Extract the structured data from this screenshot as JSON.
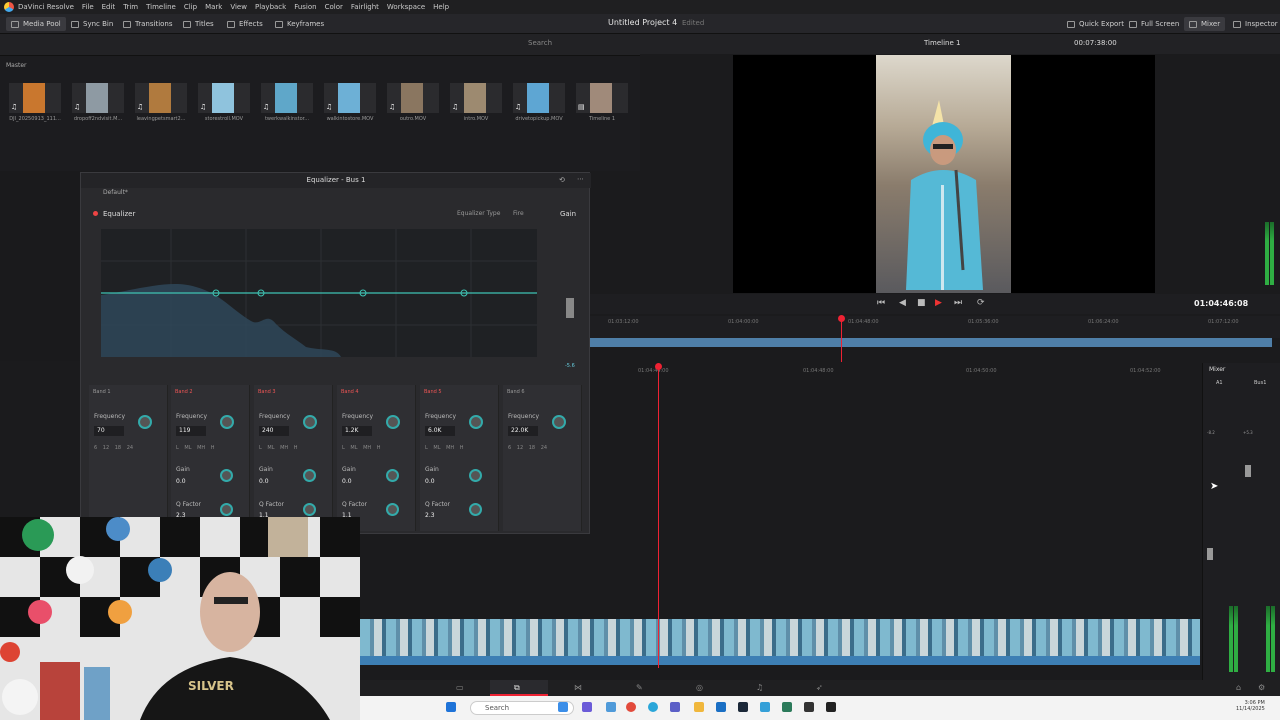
{
  "menu": [
    "DaVinci Resolve",
    "File",
    "Edit",
    "Trim",
    "Timeline",
    "Clip",
    "Mark",
    "View",
    "Playback",
    "Fusion",
    "Color",
    "Fairlight",
    "Workspace",
    "Help"
  ],
  "toolbar": {
    "media_pool": "Media Pool",
    "sync_bin": "Sync Bin",
    "transitions": "Transitions",
    "titles": "Titles",
    "effects": "Effects",
    "keyframes": "Keyframes",
    "project_title": "Untitled Project 4",
    "project_status": "Edited",
    "quick_export": "Quick Export",
    "full_screen": "Full Screen",
    "mixer": "Mixer",
    "inspector": "Inspector"
  },
  "media_pool": {
    "search_placeholder": "Search",
    "master": "Master",
    "clips": [
      {
        "name": "DJI_20250913_111...",
        "color": "#c9772e"
      },
      {
        "name": "dropoff2ndvisit.M...",
        "color": "#8e9aa3"
      },
      {
        "name": "leavingpetsmart2...",
        "color": "#b07a3e"
      },
      {
        "name": "storestroll.MOV",
        "color": "#8fc3dd"
      },
      {
        "name": "twerkwalkinstor...",
        "color": "#5fa7c9"
      },
      {
        "name": "walkintostore.MOV",
        "color": "#6db0d6"
      },
      {
        "name": "outro.MOV",
        "color": "#8a7660"
      },
      {
        "name": "intro.MOV",
        "color": "#9d8a70"
      },
      {
        "name": "drivetopickup.MOV",
        "color": "#5ea6d3"
      },
      {
        "name": "Timeline 1",
        "color": "#a08a7a"
      }
    ]
  },
  "viewer": {
    "timeline_name": "Timeline 1",
    "duration": "00:07:38:00",
    "timecode": "01:04:46:08"
  },
  "ruler_top": [
    "01:03:12:00",
    "01:04:00:00",
    "01:04:48:00",
    "01:05:36:00",
    "01:06:24:00",
    "01:07:12:00"
  ],
  "ruler_timeline": [
    "01:04:44:00",
    "01:04:48:00",
    "01:04:50:00",
    "01:04:52:00"
  ],
  "equalizer": {
    "title": "Equalizer - Bus 1",
    "preset": "Default*",
    "header": "Equalizer",
    "type_label": "Equalizer Type",
    "type_value": "Fire",
    "gain_label": "Gain",
    "gain_value": "-5.6",
    "bands": [
      {
        "name": "Band 1",
        "on": false,
        "freq": "70",
        "gain": "",
        "q": ""
      },
      {
        "name": "Band 2",
        "on": true,
        "freq": "119",
        "gain": "0.0",
        "q": "2.3"
      },
      {
        "name": "Band 3",
        "on": true,
        "freq": "240",
        "gain": "0.0",
        "q": "1.1"
      },
      {
        "name": "Band 4",
        "on": true,
        "freq": "1.2K",
        "gain": "0.0",
        "q": "1.1"
      },
      {
        "name": "Band 5",
        "on": true,
        "freq": "6.0K",
        "gain": "0.0",
        "q": "2.3"
      },
      {
        "name": "Band 6",
        "on": false,
        "freq": "22.0K",
        "gain": "",
        "q": ""
      }
    ],
    "slope_labels": [
      "6",
      "12",
      "18",
      "24"
    ],
    "shape_labels": [
      "L",
      "ML",
      "MH",
      "H"
    ],
    "freq_label": "Frequency",
    "gain_row_label": "Gain",
    "q_label": "Q Factor"
  },
  "mixer": {
    "title": "Mixer",
    "ch1": "A1",
    "ch2": "Bus1",
    "val1": "-8.2",
    "val2": "+5.3"
  },
  "taskbar": {
    "search": "Search",
    "time": "3:06 PM",
    "date": "11/14/2025"
  }
}
